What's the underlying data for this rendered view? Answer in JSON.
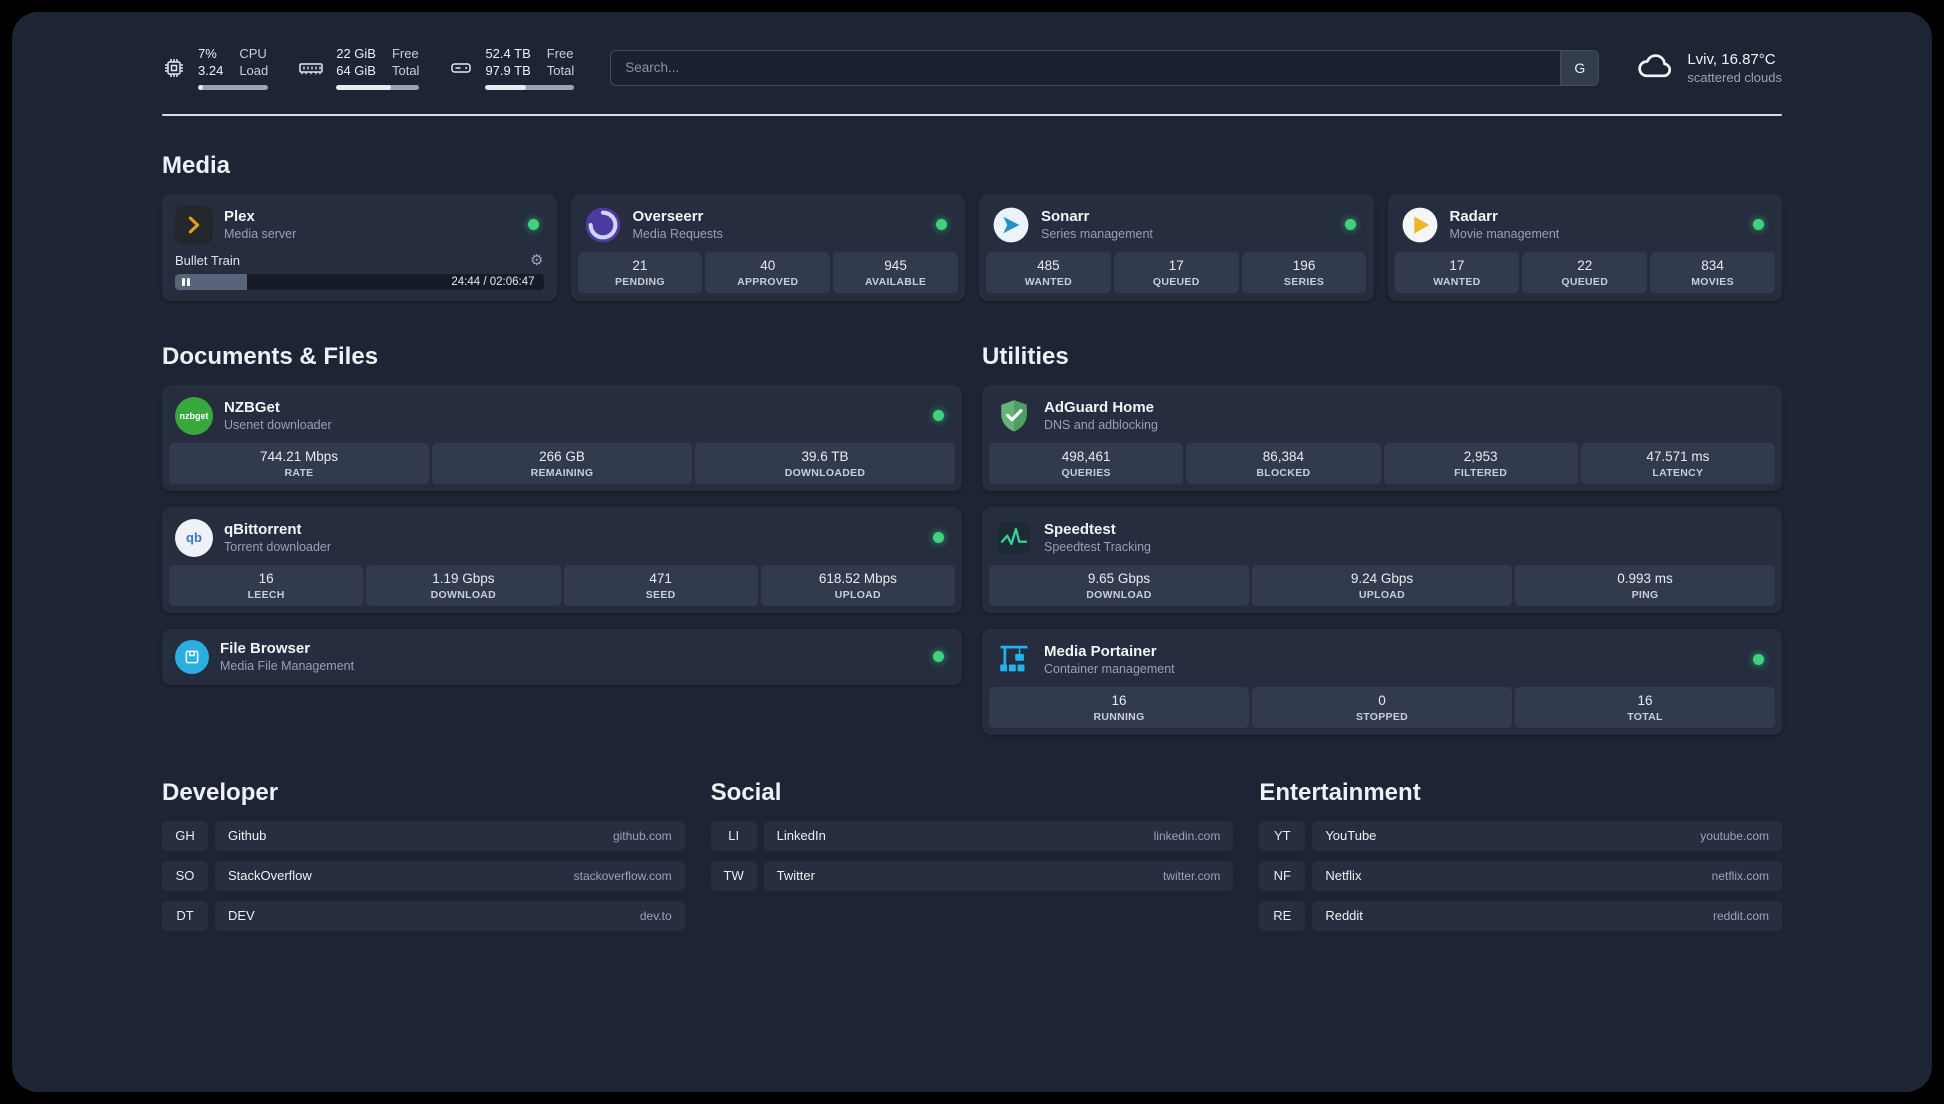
{
  "colors": {
    "status_online": "#3ed37c",
    "plex_accent": "#e5a00d",
    "overseerr_accent": "#5d4fb8",
    "sonarr_accent": "#2193c9",
    "radarr_accent": "#f0b429",
    "nzbget_accent": "#37a93c",
    "qbittorrent_accent": "#3c76c2",
    "filebrowser_accent": "#2baee0",
    "adguard_accent": "#67b279",
    "speedtest_accent": "#36d399",
    "portainer_accent": "#1fb5ec"
  },
  "topbar": {
    "cpu": {
      "value_top": "7%",
      "value_bottom": "3.24",
      "label_top": "CPU",
      "label_bottom": "Load",
      "bar_width": "7%"
    },
    "memory": {
      "value_top": "22 GiB",
      "value_bottom": "64 GiB",
      "label_top": "Free",
      "label_bottom": "Total",
      "bar_width": "66%"
    },
    "disk": {
      "value_top": "52.4 TB",
      "value_bottom": "97.9 TB",
      "label_top": "Free",
      "label_bottom": "Total",
      "bar_width": "46%"
    },
    "search": {
      "placeholder": "Search...",
      "provider_label": "G"
    },
    "weather": {
      "location": "Lviv, 16.87°C",
      "condition": "scattered clouds"
    }
  },
  "media": {
    "title": "Media",
    "plex": {
      "name": "Plex",
      "description": "Media server",
      "now_playing": "Bullet Train",
      "time": "24:44 / 02:06:47",
      "progress": "19.5%"
    },
    "overseerr": {
      "name": "Overseerr",
      "description": "Media Requests",
      "stats": [
        {
          "value": "21",
          "label": "PENDING"
        },
        {
          "value": "40",
          "label": "APPROVED"
        },
        {
          "value": "945",
          "label": "AVAILABLE"
        }
      ]
    },
    "sonarr": {
      "name": "Sonarr",
      "description": "Series management",
      "stats": [
        {
          "value": "485",
          "label": "WANTED"
        },
        {
          "value": "17",
          "label": "QUEUED"
        },
        {
          "value": "196",
          "label": "SERIES"
        }
      ]
    },
    "radarr": {
      "name": "Radarr",
      "description": "Movie management",
      "stats": [
        {
          "value": "17",
          "label": "WANTED"
        },
        {
          "value": "22",
          "label": "QUEUED"
        },
        {
          "value": "834",
          "label": "MOVIES"
        }
      ]
    }
  },
  "documents": {
    "title": "Documents & Files",
    "nzbget": {
      "name": "NZBGet",
      "description": "Usenet downloader",
      "icon_text": "nzbget",
      "stats": [
        {
          "value": "744.21 Mbps",
          "label": "RATE"
        },
        {
          "value": "266 GB",
          "label": "REMAINING"
        },
        {
          "value": "39.6 TB",
          "label": "DOWNLOADED"
        }
      ]
    },
    "qbittorrent": {
      "name": "qBittorrent",
      "description": "Torrent downloader",
      "icon_text": "qb",
      "stats": [
        {
          "value": "16",
          "label": "LEECH"
        },
        {
          "value": "1.19 Gbps",
          "label": "DOWNLOAD"
        },
        {
          "value": "471",
          "label": "SEED"
        },
        {
          "value": "618.52 Mbps",
          "label": "UPLOAD"
        }
      ]
    },
    "filebrowser": {
      "name": "File Browser",
      "description": "Media File Management"
    }
  },
  "utilities": {
    "title": "Utilities",
    "adguard": {
      "name": "AdGuard Home",
      "description": "DNS and adblocking",
      "stats": [
        {
          "value": "498,461",
          "label": "QUERIES"
        },
        {
          "value": "86,384",
          "label": "BLOCKED"
        },
        {
          "value": "2,953",
          "label": "FILTERED"
        },
        {
          "value": "47.571 ms",
          "label": "LATENCY"
        }
      ]
    },
    "speedtest": {
      "name": "Speedtest",
      "description": "Speedtest Tracking",
      "stats": [
        {
          "value": "9.65 Gbps",
          "label": "DOWNLOAD"
        },
        {
          "value": "9.24 Gbps",
          "label": "UPLOAD"
        },
        {
          "value": "0.993 ms",
          "label": "PING"
        }
      ]
    },
    "portainer": {
      "name": "Media Portainer",
      "description": "Container management",
      "stats": [
        {
          "value": "16",
          "label": "RUNNING"
        },
        {
          "value": "0",
          "label": "STOPPED"
        },
        {
          "value": "16",
          "label": "TOTAL"
        }
      ]
    }
  },
  "bookmarks": [
    {
      "title": "Developer",
      "items": [
        {
          "abbr": "GH",
          "name": "Github",
          "url": "github.com"
        },
        {
          "abbr": "SO",
          "name": "StackOverflow",
          "url": "stackoverflow.com"
        },
        {
          "abbr": "DT",
          "name": "DEV",
          "url": "dev.to"
        }
      ]
    },
    {
      "title": "Social",
      "items": [
        {
          "abbr": "LI",
          "name": "LinkedIn",
          "url": "linkedin.com"
        },
        {
          "abbr": "TW",
          "name": "Twitter",
          "url": "twitter.com"
        }
      ]
    },
    {
      "title": "Entertainment",
      "items": [
        {
          "abbr": "YT",
          "name": "YouTube",
          "url": "youtube.com"
        },
        {
          "abbr": "NF",
          "name": "Netflix",
          "url": "netflix.com"
        },
        {
          "abbr": "RE",
          "name": "Reddit",
          "url": "reddit.com"
        }
      ]
    }
  ]
}
